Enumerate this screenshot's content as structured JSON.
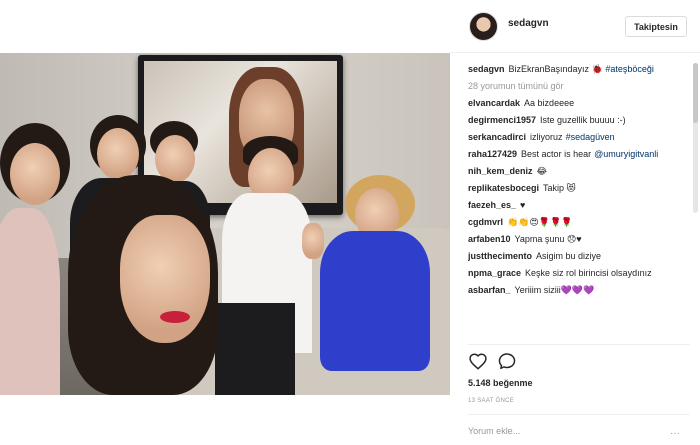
{
  "header": {
    "username": "sedagvn",
    "follow_label": "Takiptesin"
  },
  "caption": {
    "username": "sedagvn",
    "text": "BizEkranBaşındayız",
    "emoji": "🐞",
    "hashtag": "#ateşböceği"
  },
  "view_all_comments": "28 yorumun tümünü gör",
  "comments": [
    {
      "user": "elvancardak",
      "text": "Aa bizdeeee"
    },
    {
      "user": "degirmenci1957",
      "text": "Iste guzellik buuuu :-)"
    },
    {
      "user": "serkancadirci",
      "text": "izliyoruz",
      "tag": "#sedagüven"
    },
    {
      "user": "raha127429",
      "text": "Best actor is hear",
      "tag": "@umuryigitvanli"
    },
    {
      "user": "nih_kem_deniz",
      "text": "😂"
    },
    {
      "user": "replikatesbocegi",
      "text": "Takip 😻"
    },
    {
      "user": "faezeh_es_",
      "text": "♥"
    },
    {
      "user": "cgdmvrl",
      "text": "👏👏😍🌹🌹🌹"
    },
    {
      "user": "arfaben10",
      "text": "Yapma şunu 😞♥"
    },
    {
      "user": "justthecimento",
      "text": "Asigim bu diziye"
    },
    {
      "user": "npma_grace",
      "text": "Keşke siz rol birincisi olsaydınız"
    },
    {
      "user": "asbarfan_",
      "text": "Yeriiim siziii💜💜💜"
    }
  ],
  "likes": "5.148 beğenme",
  "timestamp": "13 SAAT ÖNCE",
  "add_comment_placeholder": "Yorum ekle...",
  "more_label": "···",
  "icons": {
    "heart": "heart-icon",
    "comment": "comment-icon",
    "more": "more-options-icon"
  },
  "colors": {
    "link": "#003569",
    "muted": "#999999",
    "text": "#262626"
  }
}
